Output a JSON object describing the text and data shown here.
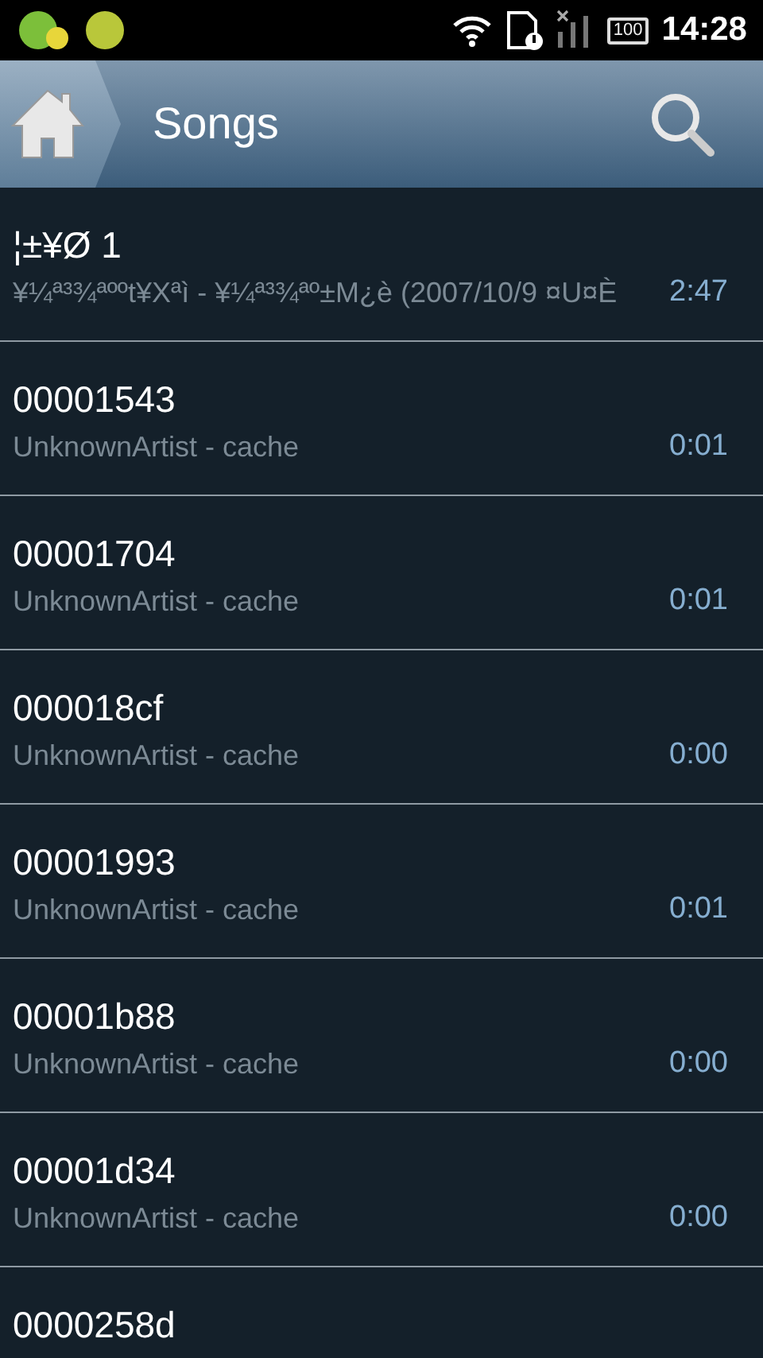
{
  "status_bar": {
    "battery": "100",
    "time": "14:28"
  },
  "header": {
    "title": "Songs"
  },
  "songs": [
    {
      "title": "¦±¥Ø 1",
      "subtitle": "¥¼ª³¾ªººt¥Xªì - ¥¼ª³¾ªº±M¿è (2007/10/9 ¤U¤È",
      "duration": "2:47"
    },
    {
      "title": "00001543",
      "subtitle": "UnknownArtist - cache",
      "duration": "0:01"
    },
    {
      "title": "00001704",
      "subtitle": "UnknownArtist - cache",
      "duration": "0:01"
    },
    {
      "title": "000018cf",
      "subtitle": "UnknownArtist - cache",
      "duration": "0:00"
    },
    {
      "title": "00001993",
      "subtitle": "UnknownArtist - cache",
      "duration": "0:01"
    },
    {
      "title": "00001b88",
      "subtitle": "UnknownArtist - cache",
      "duration": "0:00"
    },
    {
      "title": "00001d34",
      "subtitle": "UnknownArtist - cache",
      "duration": "0:00"
    },
    {
      "title": "0000258d"
    }
  ]
}
